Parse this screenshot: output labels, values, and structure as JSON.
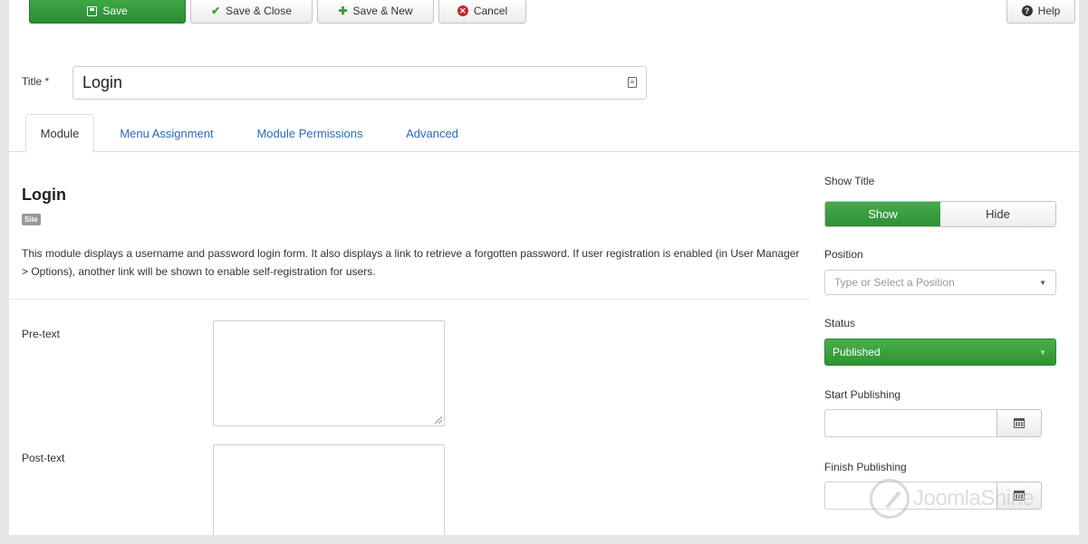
{
  "toolbar": {
    "save_label": "Save",
    "save_close_label": "Save & Close",
    "save_new_label": "Save & New",
    "cancel_label": "Cancel",
    "help_label": "Help"
  },
  "title_field": {
    "label": "Title *",
    "value": "Login"
  },
  "tabs": [
    {
      "label": "Module",
      "active": true
    },
    {
      "label": "Menu Assignment",
      "active": false
    },
    {
      "label": "Module Permissions",
      "active": false
    },
    {
      "label": "Advanced",
      "active": false
    }
  ],
  "module": {
    "name": "Login",
    "badge": "Site",
    "description": "This module displays a username and password login form. It also displays a link to retrieve a forgotten password. If user registration is enabled (in User Manager > Options), another link will be shown to enable self-registration for users."
  },
  "fields": {
    "pre_text_label": "Pre-text",
    "post_text_label": "Post-text"
  },
  "sidebar": {
    "show_title_label": "Show Title",
    "show_label": "Show",
    "hide_label": "Hide",
    "show_title_selected": "Show",
    "position_label": "Position",
    "position_placeholder": "Type or Select a Position",
    "status_label": "Status",
    "status_value": "Published",
    "start_publishing_label": "Start Publishing",
    "finish_publishing_label": "Finish Publishing"
  },
  "watermark": {
    "text": "JoomlaShine"
  },
  "colors": {
    "primary_green": "#2f922f",
    "link_blue": "#2a6ab5",
    "cancel_red": "#c7252a"
  }
}
